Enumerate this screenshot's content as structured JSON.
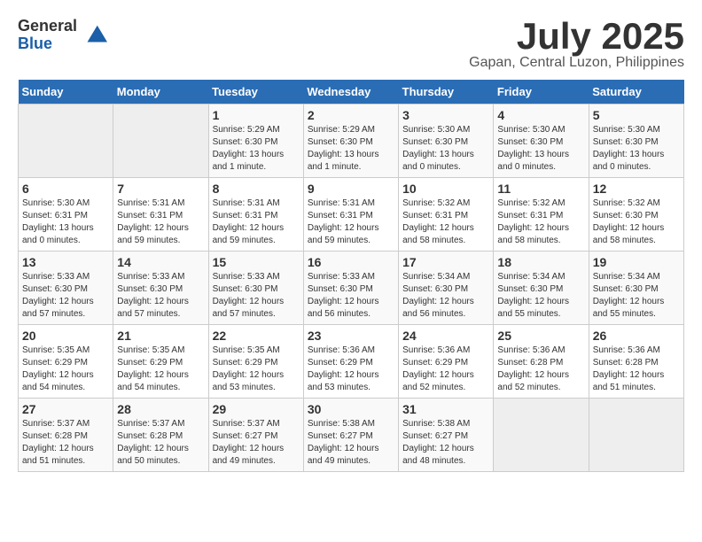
{
  "logo": {
    "general": "General",
    "blue": "Blue"
  },
  "title": "July 2025",
  "location": "Gapan, Central Luzon, Philippines",
  "weekdays": [
    "Sunday",
    "Monday",
    "Tuesday",
    "Wednesday",
    "Thursday",
    "Friday",
    "Saturday"
  ],
  "weeks": [
    [
      {
        "day": "",
        "empty": true
      },
      {
        "day": "",
        "empty": true
      },
      {
        "day": "1",
        "sunrise": "5:29 AM",
        "sunset": "6:30 PM",
        "daylight": "13 hours and 1 minute."
      },
      {
        "day": "2",
        "sunrise": "5:29 AM",
        "sunset": "6:30 PM",
        "daylight": "13 hours and 1 minute."
      },
      {
        "day": "3",
        "sunrise": "5:30 AM",
        "sunset": "6:30 PM",
        "daylight": "13 hours and 0 minutes."
      },
      {
        "day": "4",
        "sunrise": "5:30 AM",
        "sunset": "6:30 PM",
        "daylight": "13 hours and 0 minutes."
      },
      {
        "day": "5",
        "sunrise": "5:30 AM",
        "sunset": "6:30 PM",
        "daylight": "13 hours and 0 minutes."
      }
    ],
    [
      {
        "day": "6",
        "sunrise": "5:30 AM",
        "sunset": "6:31 PM",
        "daylight": "13 hours and 0 minutes."
      },
      {
        "day": "7",
        "sunrise": "5:31 AM",
        "sunset": "6:31 PM",
        "daylight": "12 hours and 59 minutes."
      },
      {
        "day": "8",
        "sunrise": "5:31 AM",
        "sunset": "6:31 PM",
        "daylight": "12 hours and 59 minutes."
      },
      {
        "day": "9",
        "sunrise": "5:31 AM",
        "sunset": "6:31 PM",
        "daylight": "12 hours and 59 minutes."
      },
      {
        "day": "10",
        "sunrise": "5:32 AM",
        "sunset": "6:31 PM",
        "daylight": "12 hours and 58 minutes."
      },
      {
        "day": "11",
        "sunrise": "5:32 AM",
        "sunset": "6:31 PM",
        "daylight": "12 hours and 58 minutes."
      },
      {
        "day": "12",
        "sunrise": "5:32 AM",
        "sunset": "6:30 PM",
        "daylight": "12 hours and 58 minutes."
      }
    ],
    [
      {
        "day": "13",
        "sunrise": "5:33 AM",
        "sunset": "6:30 PM",
        "daylight": "12 hours and 57 minutes."
      },
      {
        "day": "14",
        "sunrise": "5:33 AM",
        "sunset": "6:30 PM",
        "daylight": "12 hours and 57 minutes."
      },
      {
        "day": "15",
        "sunrise": "5:33 AM",
        "sunset": "6:30 PM",
        "daylight": "12 hours and 57 minutes."
      },
      {
        "day": "16",
        "sunrise": "5:33 AM",
        "sunset": "6:30 PM",
        "daylight": "12 hours and 56 minutes."
      },
      {
        "day": "17",
        "sunrise": "5:34 AM",
        "sunset": "6:30 PM",
        "daylight": "12 hours and 56 minutes."
      },
      {
        "day": "18",
        "sunrise": "5:34 AM",
        "sunset": "6:30 PM",
        "daylight": "12 hours and 55 minutes."
      },
      {
        "day": "19",
        "sunrise": "5:34 AM",
        "sunset": "6:30 PM",
        "daylight": "12 hours and 55 minutes."
      }
    ],
    [
      {
        "day": "20",
        "sunrise": "5:35 AM",
        "sunset": "6:29 PM",
        "daylight": "12 hours and 54 minutes."
      },
      {
        "day": "21",
        "sunrise": "5:35 AM",
        "sunset": "6:29 PM",
        "daylight": "12 hours and 54 minutes."
      },
      {
        "day": "22",
        "sunrise": "5:35 AM",
        "sunset": "6:29 PM",
        "daylight": "12 hours and 53 minutes."
      },
      {
        "day": "23",
        "sunrise": "5:36 AM",
        "sunset": "6:29 PM",
        "daylight": "12 hours and 53 minutes."
      },
      {
        "day": "24",
        "sunrise": "5:36 AM",
        "sunset": "6:29 PM",
        "daylight": "12 hours and 52 minutes."
      },
      {
        "day": "25",
        "sunrise": "5:36 AM",
        "sunset": "6:28 PM",
        "daylight": "12 hours and 52 minutes."
      },
      {
        "day": "26",
        "sunrise": "5:36 AM",
        "sunset": "6:28 PM",
        "daylight": "12 hours and 51 minutes."
      }
    ],
    [
      {
        "day": "27",
        "sunrise": "5:37 AM",
        "sunset": "6:28 PM",
        "daylight": "12 hours and 51 minutes."
      },
      {
        "day": "28",
        "sunrise": "5:37 AM",
        "sunset": "6:28 PM",
        "daylight": "12 hours and 50 minutes."
      },
      {
        "day": "29",
        "sunrise": "5:37 AM",
        "sunset": "6:27 PM",
        "daylight": "12 hours and 49 minutes."
      },
      {
        "day": "30",
        "sunrise": "5:38 AM",
        "sunset": "6:27 PM",
        "daylight": "12 hours and 49 minutes."
      },
      {
        "day": "31",
        "sunrise": "5:38 AM",
        "sunset": "6:27 PM",
        "daylight": "12 hours and 48 minutes."
      },
      {
        "day": "",
        "empty": true
      },
      {
        "day": "",
        "empty": true
      }
    ]
  ],
  "labels": {
    "sunrise_prefix": "Sunrise: ",
    "sunset_prefix": "Sunset: ",
    "daylight_prefix": "Daylight: "
  }
}
